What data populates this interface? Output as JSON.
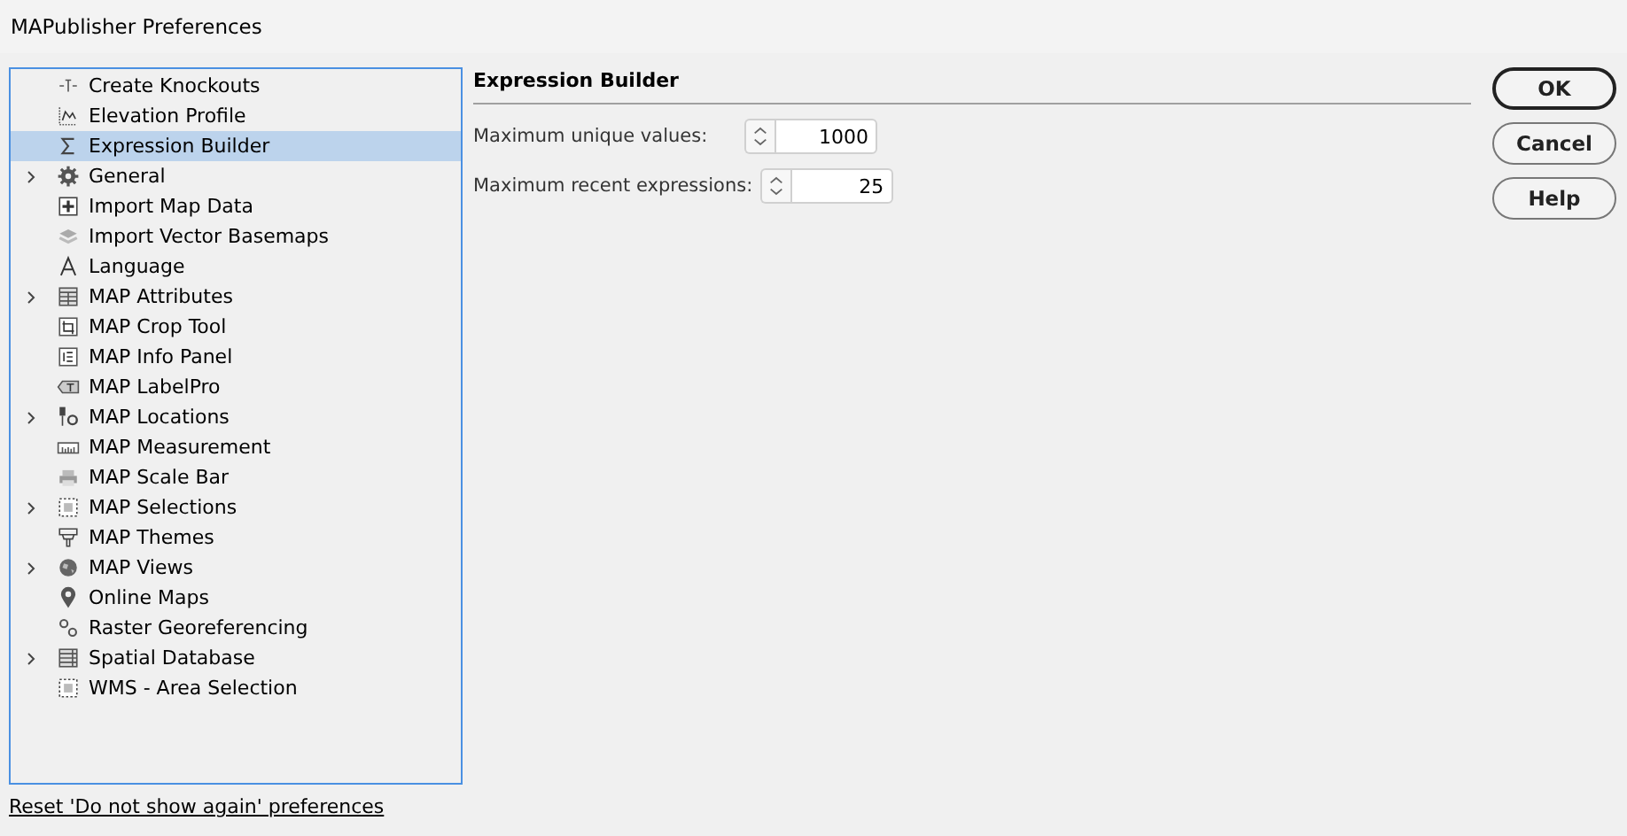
{
  "window": {
    "title": "MAPublisher Preferences"
  },
  "tree": {
    "items": [
      {
        "label": "Create Knockouts",
        "kind": "knockout",
        "expandable": false,
        "selected": false
      },
      {
        "label": "Elevation Profile",
        "kind": "chart",
        "expandable": false,
        "selected": false
      },
      {
        "label": "Expression Builder",
        "kind": "sigma",
        "expandable": false,
        "selected": true
      },
      {
        "label": "General",
        "kind": "gear",
        "expandable": true,
        "selected": false
      },
      {
        "label": "Import Map Data",
        "kind": "plus",
        "expandable": false,
        "selected": false
      },
      {
        "label": "Import Vector Basemaps",
        "kind": "layers",
        "expandable": false,
        "selected": false
      },
      {
        "label": "Language",
        "kind": "letter",
        "expandable": false,
        "selected": false
      },
      {
        "label": "MAP Attributes",
        "kind": "table",
        "expandable": true,
        "selected": false
      },
      {
        "label": "MAP Crop Tool",
        "kind": "crop",
        "expandable": false,
        "selected": false
      },
      {
        "label": "MAP Info Panel",
        "kind": "info",
        "expandable": false,
        "selected": false
      },
      {
        "label": "MAP LabelPro",
        "kind": "tag",
        "expandable": false,
        "selected": false
      },
      {
        "label": "MAP Locations",
        "kind": "pin-gear",
        "expandable": true,
        "selected": false
      },
      {
        "label": "MAP Measurement",
        "kind": "ruler",
        "expandable": false,
        "selected": false
      },
      {
        "label": "MAP Scale Bar",
        "kind": "printer",
        "expandable": false,
        "selected": false
      },
      {
        "label": "MAP Selections",
        "kind": "selection",
        "expandable": true,
        "selected": false
      },
      {
        "label": "MAP Themes",
        "kind": "brush",
        "expandable": false,
        "selected": false
      },
      {
        "label": "MAP Views",
        "kind": "globe",
        "expandable": true,
        "selected": false
      },
      {
        "label": "Online Maps",
        "kind": "pin",
        "expandable": false,
        "selected": false
      },
      {
        "label": "Raster Georeferencing",
        "kind": "gears",
        "expandable": false,
        "selected": false
      },
      {
        "label": "Spatial Database",
        "kind": "list",
        "expandable": true,
        "selected": false
      },
      {
        "label": "WMS - Area Selection",
        "kind": "selection",
        "expandable": false,
        "selected": false
      }
    ]
  },
  "reset_link": "Reset 'Do not show again' preferences",
  "section": {
    "title": "Expression Builder",
    "fields": [
      {
        "label": "Maximum unique values:",
        "value": "1000"
      },
      {
        "label": "Maximum recent expressions:",
        "value": "25"
      }
    ]
  },
  "buttons": [
    {
      "label": "OK",
      "default": true
    },
    {
      "label": "Cancel",
      "default": false
    },
    {
      "label": "Help",
      "default": false
    }
  ]
}
